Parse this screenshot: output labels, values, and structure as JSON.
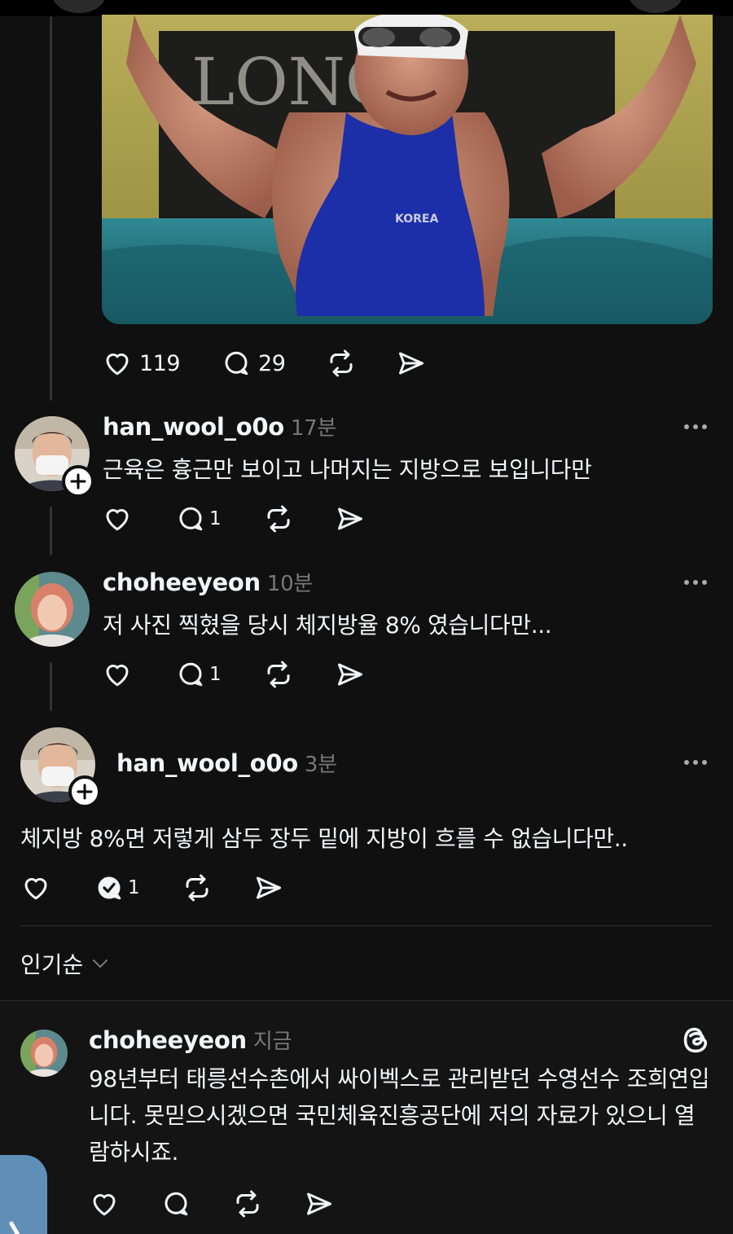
{
  "post": {
    "likes": "119",
    "replies": "29"
  },
  "comments": [
    {
      "username": "han_wool_o0o",
      "time": "17분",
      "text": "근육은 흉근만 보이고 나머지는 지방으로 보입니다만",
      "reply_count": "1"
    },
    {
      "username": "choheeyeon",
      "time": "10분",
      "text": "저 사진 찍혔을 당시 체지방율 8% 였습니다만...",
      "reply_count": "1"
    },
    {
      "username": "han_wool_o0o",
      "time": "3분",
      "text": "체지방 8%면 저렇게 삼두 장두 밑에 지방이 흐를 수 없습니다만..",
      "reply_count": "1"
    }
  ],
  "sort": {
    "label": "인기순"
  },
  "reply": {
    "username": "choheeyeon",
    "time": "지금",
    "text": "98년부터 태릉선수촌에서 싸이벡스로 관리받던 수영선수 조희연입니다. 못믿으시겠으면 국민체육진흥공단에 저의 자료가 있으니 열람하시죠."
  },
  "photo": {
    "sign_text": "LONGI",
    "suit_text": "KOREA"
  },
  "icons": {
    "like": "heart-icon",
    "reply": "speech-bubble-icon",
    "repost": "repost-icon",
    "share": "send-icon",
    "more": "more-dots-icon",
    "follow": "plus-icon",
    "threads": "threads-logo-icon",
    "sort": "chevron-down-icon"
  },
  "colors": {
    "background": "#101010",
    "text": "#f3f5f7",
    "muted": "#777777"
  }
}
